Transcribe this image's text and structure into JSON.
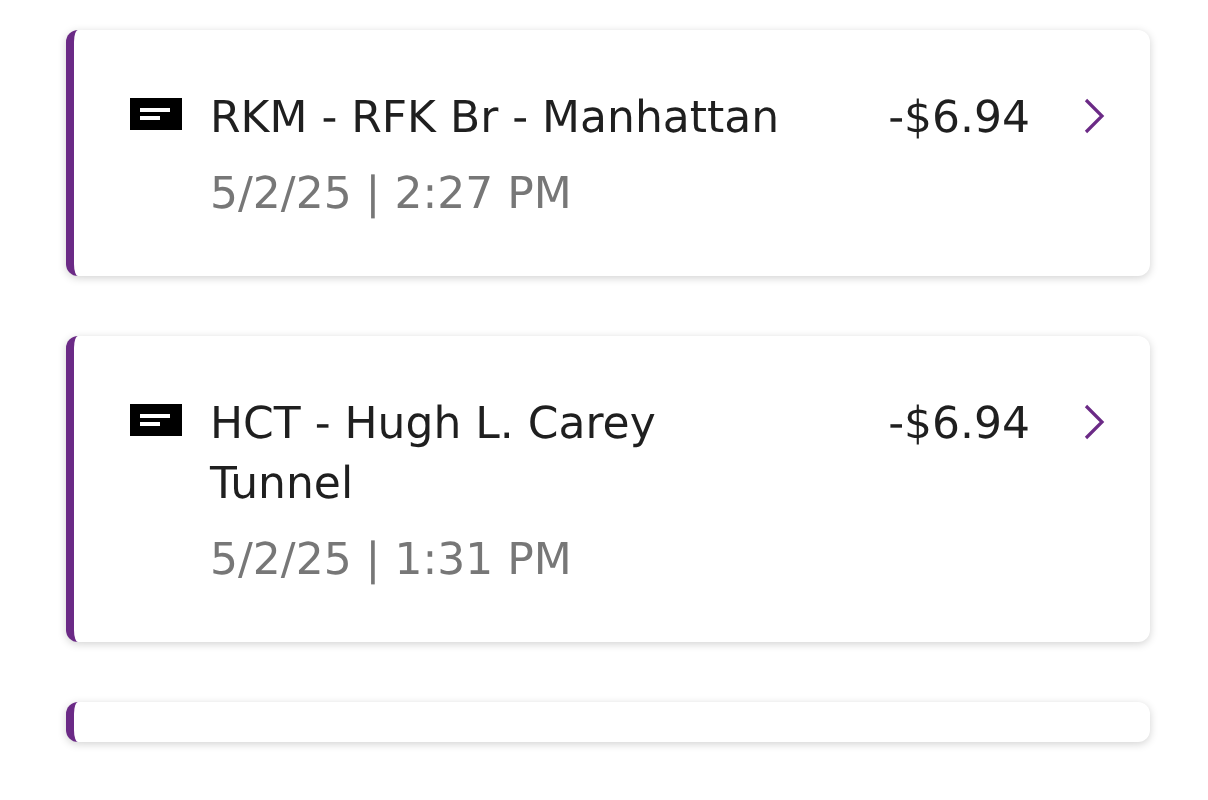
{
  "transactions": [
    {
      "title": "RKM - RFK Br - Manhattan",
      "amount": "-$6.94",
      "datetime": "5/2/25 | 2:27 PM"
    },
    {
      "title": "HCT - Hugh L. Carey Tunnel",
      "amount": "-$6.94",
      "datetime": "5/2/25 | 1:31 PM"
    }
  ]
}
